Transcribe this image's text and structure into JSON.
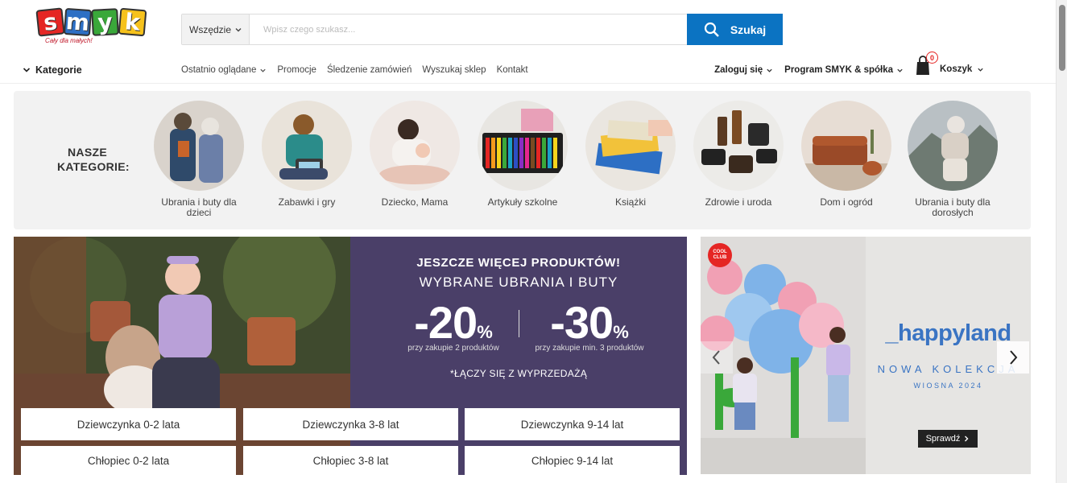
{
  "header": {
    "logo_text": "smyk",
    "tagline": "Cały dla małych!",
    "search": {
      "scope": "Wszędzie",
      "placeholder": "Wpisz czego szukasz...",
      "button_label": "Szukaj"
    }
  },
  "nav": {
    "categories_label": "Kategorie",
    "links": [
      "Ostatnio oglądane",
      "Promocje",
      "Śledzenie zamówień",
      "Wyszukaj sklep",
      "Kontakt"
    ],
    "login": "Zaloguj się",
    "program": "Program SMYK & spółka",
    "cart_label": "Koszyk",
    "cart_count": "0"
  },
  "categories": {
    "heading": "NASZE KATEGORIE:",
    "items": [
      {
        "label": "Ubrania i buty dla dzieci"
      },
      {
        "label": "Zabawki i gry"
      },
      {
        "label": "Dziecko, Mama"
      },
      {
        "label": "Artykuły szkolne"
      },
      {
        "label": "Książki"
      },
      {
        "label": "Zdrowie i uroda"
      },
      {
        "label": "Dom i ogród"
      },
      {
        "label": "Ubrania i buty dla dorosłych"
      }
    ]
  },
  "promo": {
    "line1": "JESZCZE WIĘCEJ PRODUKTÓW!",
    "line2": "WYBRANE UBRANIA I BUTY",
    "discount1": "-20",
    "discount1_note": "przy zakupie 2 produktów",
    "discount2": "-30",
    "discount2_note": "przy zakupie min. 3 produktów",
    "percent": "%",
    "note": "*ŁĄCZY SIĘ Z WYPRZEDAŻĄ",
    "segments": [
      "Dziewczynka 0-2 lata",
      "Dziewczynka 3-8 lat",
      "Dziewczynka 9-14 lat",
      "Chłopiec 0-2 lata",
      "Chłopiec 3-8 lat",
      "Chłopiec 9-14 lat"
    ]
  },
  "side_banner": {
    "badge": "COOL CLUB",
    "brand": "_happyland",
    "collection": "NOWA KOLEKCJA",
    "season": "WIOSNA 2024",
    "cta": "Sprawdź"
  },
  "colors": {
    "accent": "#0b73c2",
    "promo_bg": "#4a3f68",
    "brand_blue": "#3a74c3"
  }
}
